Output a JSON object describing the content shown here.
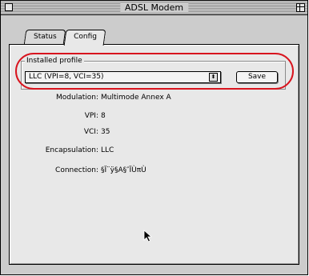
{
  "window": {
    "title": "ADSL Modem"
  },
  "tabs": [
    {
      "label": "Status",
      "selected": false
    },
    {
      "label": "Config",
      "selected": true
    }
  ],
  "profile": {
    "group_label": "Installed profile",
    "selected_value": "LLC (VPI=8, VCI=35)",
    "save_label": "Save"
  },
  "details": {
    "modulation_label": "Modulation:",
    "modulation_value": "Multimode Annex A",
    "vpi_label": "VPI:",
    "vpi_value": "8",
    "vci_label": "VCI:",
    "vci_value": "35",
    "encapsulation_label": "Encapsulation:",
    "encapsulation_value": "LLC",
    "connection_label": "Connection:",
    "connection_value": "§Ï¨ÿ§A§″ÏÙπÙ"
  },
  "colors": {
    "annotation": "#d8141e",
    "panel": "#e8e8e8",
    "window": "#cccccc"
  }
}
